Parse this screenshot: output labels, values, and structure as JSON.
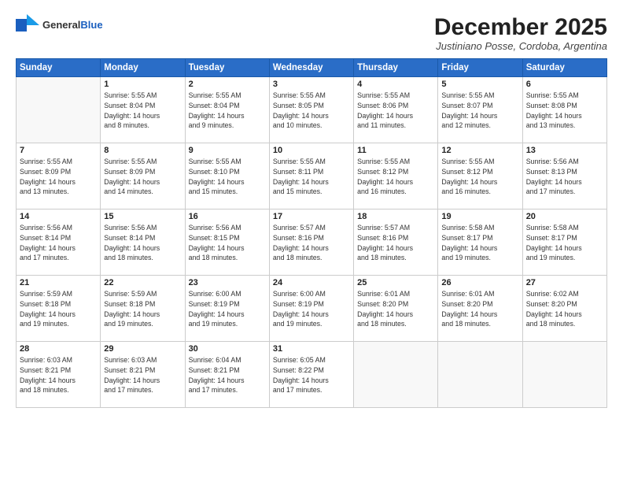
{
  "logo": {
    "general": "General",
    "blue": "Blue"
  },
  "title": "December 2025",
  "subtitle": "Justiniano Posse, Cordoba, Argentina",
  "days_of_week": [
    "Sunday",
    "Monday",
    "Tuesday",
    "Wednesday",
    "Thursday",
    "Friday",
    "Saturday"
  ],
  "weeks": [
    [
      {
        "day": "",
        "info": ""
      },
      {
        "day": "1",
        "info": "Sunrise: 5:55 AM\nSunset: 8:04 PM\nDaylight: 14 hours\nand 8 minutes."
      },
      {
        "day": "2",
        "info": "Sunrise: 5:55 AM\nSunset: 8:04 PM\nDaylight: 14 hours\nand 9 minutes."
      },
      {
        "day": "3",
        "info": "Sunrise: 5:55 AM\nSunset: 8:05 PM\nDaylight: 14 hours\nand 10 minutes."
      },
      {
        "day": "4",
        "info": "Sunrise: 5:55 AM\nSunset: 8:06 PM\nDaylight: 14 hours\nand 11 minutes."
      },
      {
        "day": "5",
        "info": "Sunrise: 5:55 AM\nSunset: 8:07 PM\nDaylight: 14 hours\nand 12 minutes."
      },
      {
        "day": "6",
        "info": "Sunrise: 5:55 AM\nSunset: 8:08 PM\nDaylight: 14 hours\nand 13 minutes."
      }
    ],
    [
      {
        "day": "7",
        "info": "Sunrise: 5:55 AM\nSunset: 8:09 PM\nDaylight: 14 hours\nand 13 minutes."
      },
      {
        "day": "8",
        "info": "Sunrise: 5:55 AM\nSunset: 8:09 PM\nDaylight: 14 hours\nand 14 minutes."
      },
      {
        "day": "9",
        "info": "Sunrise: 5:55 AM\nSunset: 8:10 PM\nDaylight: 14 hours\nand 15 minutes."
      },
      {
        "day": "10",
        "info": "Sunrise: 5:55 AM\nSunset: 8:11 PM\nDaylight: 14 hours\nand 15 minutes."
      },
      {
        "day": "11",
        "info": "Sunrise: 5:55 AM\nSunset: 8:12 PM\nDaylight: 14 hours\nand 16 minutes."
      },
      {
        "day": "12",
        "info": "Sunrise: 5:55 AM\nSunset: 8:12 PM\nDaylight: 14 hours\nand 16 minutes."
      },
      {
        "day": "13",
        "info": "Sunrise: 5:56 AM\nSunset: 8:13 PM\nDaylight: 14 hours\nand 17 minutes."
      }
    ],
    [
      {
        "day": "14",
        "info": "Sunrise: 5:56 AM\nSunset: 8:14 PM\nDaylight: 14 hours\nand 17 minutes."
      },
      {
        "day": "15",
        "info": "Sunrise: 5:56 AM\nSunset: 8:14 PM\nDaylight: 14 hours\nand 18 minutes."
      },
      {
        "day": "16",
        "info": "Sunrise: 5:56 AM\nSunset: 8:15 PM\nDaylight: 14 hours\nand 18 minutes."
      },
      {
        "day": "17",
        "info": "Sunrise: 5:57 AM\nSunset: 8:16 PM\nDaylight: 14 hours\nand 18 minutes."
      },
      {
        "day": "18",
        "info": "Sunrise: 5:57 AM\nSunset: 8:16 PM\nDaylight: 14 hours\nand 18 minutes."
      },
      {
        "day": "19",
        "info": "Sunrise: 5:58 AM\nSunset: 8:17 PM\nDaylight: 14 hours\nand 19 minutes."
      },
      {
        "day": "20",
        "info": "Sunrise: 5:58 AM\nSunset: 8:17 PM\nDaylight: 14 hours\nand 19 minutes."
      }
    ],
    [
      {
        "day": "21",
        "info": "Sunrise: 5:59 AM\nSunset: 8:18 PM\nDaylight: 14 hours\nand 19 minutes."
      },
      {
        "day": "22",
        "info": "Sunrise: 5:59 AM\nSunset: 8:18 PM\nDaylight: 14 hours\nand 19 minutes."
      },
      {
        "day": "23",
        "info": "Sunrise: 6:00 AM\nSunset: 8:19 PM\nDaylight: 14 hours\nand 19 minutes."
      },
      {
        "day": "24",
        "info": "Sunrise: 6:00 AM\nSunset: 8:19 PM\nDaylight: 14 hours\nand 19 minutes."
      },
      {
        "day": "25",
        "info": "Sunrise: 6:01 AM\nSunset: 8:20 PM\nDaylight: 14 hours\nand 18 minutes."
      },
      {
        "day": "26",
        "info": "Sunrise: 6:01 AM\nSunset: 8:20 PM\nDaylight: 14 hours\nand 18 minutes."
      },
      {
        "day": "27",
        "info": "Sunrise: 6:02 AM\nSunset: 8:20 PM\nDaylight: 14 hours\nand 18 minutes."
      }
    ],
    [
      {
        "day": "28",
        "info": "Sunrise: 6:03 AM\nSunset: 8:21 PM\nDaylight: 14 hours\nand 18 minutes."
      },
      {
        "day": "29",
        "info": "Sunrise: 6:03 AM\nSunset: 8:21 PM\nDaylight: 14 hours\nand 17 minutes."
      },
      {
        "day": "30",
        "info": "Sunrise: 6:04 AM\nSunset: 8:21 PM\nDaylight: 14 hours\nand 17 minutes."
      },
      {
        "day": "31",
        "info": "Sunrise: 6:05 AM\nSunset: 8:22 PM\nDaylight: 14 hours\nand 17 minutes."
      },
      {
        "day": "",
        "info": ""
      },
      {
        "day": "",
        "info": ""
      },
      {
        "day": "",
        "info": ""
      }
    ]
  ]
}
